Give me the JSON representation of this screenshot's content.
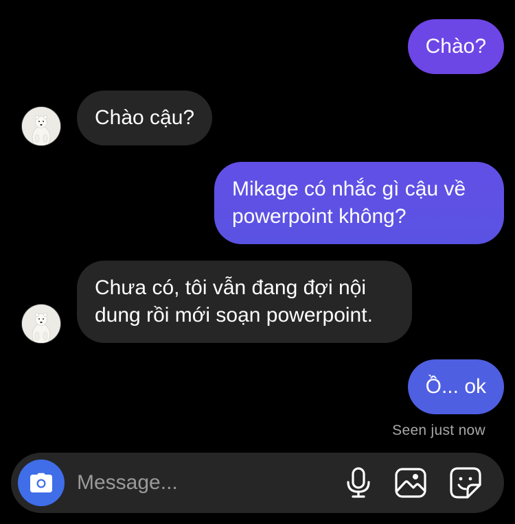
{
  "thread": {
    "messages": [
      {
        "direction": "outgoing",
        "text": "Chào?",
        "color": "#6d46e6"
      },
      {
        "direction": "incoming",
        "text": "Chào cậu?",
        "color": "#262626"
      },
      {
        "direction": "outgoing",
        "text": "Mikage có nhắc gì cậu về powerpoint không?",
        "color": "#5c51e4"
      },
      {
        "direction": "incoming",
        "text": "Chưa có, tôi vẫn đang đợi nội dung rồi mới soạn powerpoint.",
        "color": "#262626"
      },
      {
        "direction": "outgoing",
        "text": "Ồ... ok",
        "color": "#4f5fe2"
      }
    ],
    "seen_status": "Seen just now",
    "contact_avatar_icon": "polar-bear-avatar"
  },
  "composer": {
    "placeholder": "Message...",
    "camera_icon": "camera-icon",
    "camera_color": "#3f6ee8",
    "mic_icon": "microphone-icon",
    "gallery_icon": "image-gallery-icon",
    "sticker_icon": "sticker-icon"
  }
}
